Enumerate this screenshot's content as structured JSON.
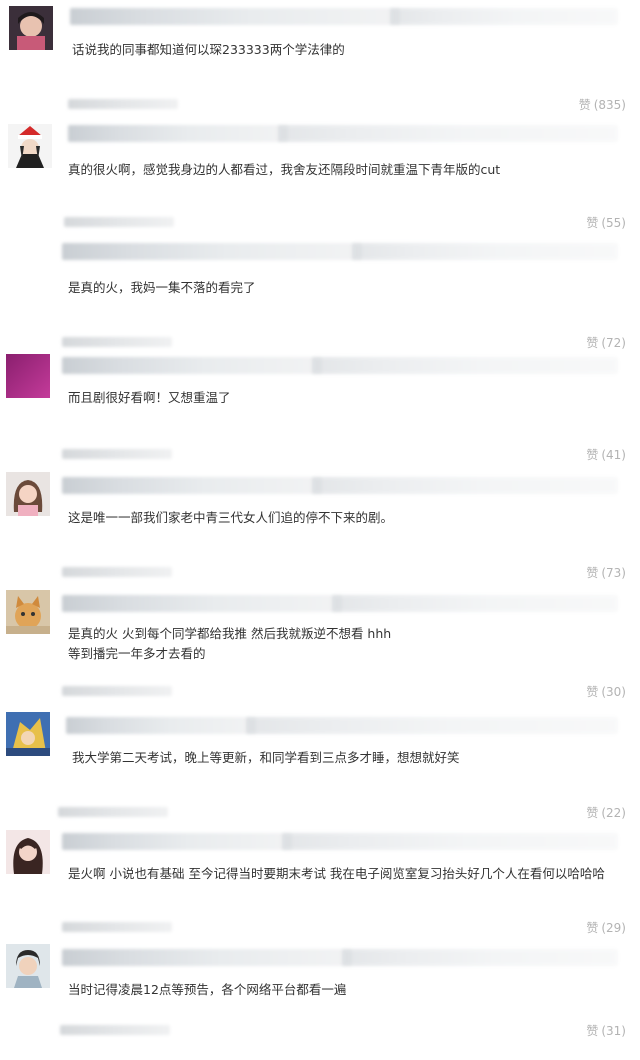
{
  "comments": [
    {
      "text_lines": [
        "话说我的同事都知道何以琛233333两个学法律的"
      ],
      "like_label": "赞",
      "like_count": "(835)",
      "avatar": "avatar-child"
    },
    {
      "text_lines": [
        "真的很火啊，感觉我身边的人都看过，我舍友还隔段时间就重温下青年版的cut"
      ],
      "like_label": "赞",
      "like_count": "(55)",
      "avatar": "avatar-anime"
    },
    {
      "text_lines": [
        "是真的火，我妈一集不落的看完了"
      ],
      "like_label": "赞",
      "like_count": "(72)",
      "avatar": "avatar-none"
    },
    {
      "text_lines": [
        "而且剧很好看啊！又想重温了"
      ],
      "like_label": "赞",
      "like_count": "(41)",
      "avatar": "avatar-purple"
    },
    {
      "text_lines": [
        "这是唯一一部我们家老中青三代女人们追的停不下来的剧。"
      ],
      "like_label": "赞",
      "like_count": "(73)",
      "avatar": "avatar-girl"
    },
    {
      "text_lines": [
        "是真的火 火到每个同学都给我推 然后我就叛逆不想看 hhh",
        "等到播完一年多才去看的"
      ],
      "like_label": "赞",
      "like_count": "(30)",
      "avatar": "avatar-cat"
    },
    {
      "text_lines": [
        "我大学第二天考试，晚上等更新，和同学看到三点多才睡，想想就好笑"
      ],
      "like_label": "赞",
      "like_count": "(22)",
      "avatar": "avatar-cartoon"
    },
    {
      "text_lines": [
        "是火啊 小说也有基础 至今记得当时要期末考试 我在电子阅览室复习抬头好几个人在看何以哈哈哈"
      ],
      "like_label": "赞",
      "like_count": "(29)",
      "avatar": "avatar-woman"
    },
    {
      "text_lines": [
        "当时记得凌晨12点等预告，各个网络平台都看一遍"
      ],
      "like_label": "赞",
      "like_count": "(31)",
      "avatar": "avatar-man"
    }
  ],
  "colors": {
    "text": "#333333",
    "like": "#b3b3b3",
    "blur": "#d9dde1",
    "background": "#ffffff"
  }
}
